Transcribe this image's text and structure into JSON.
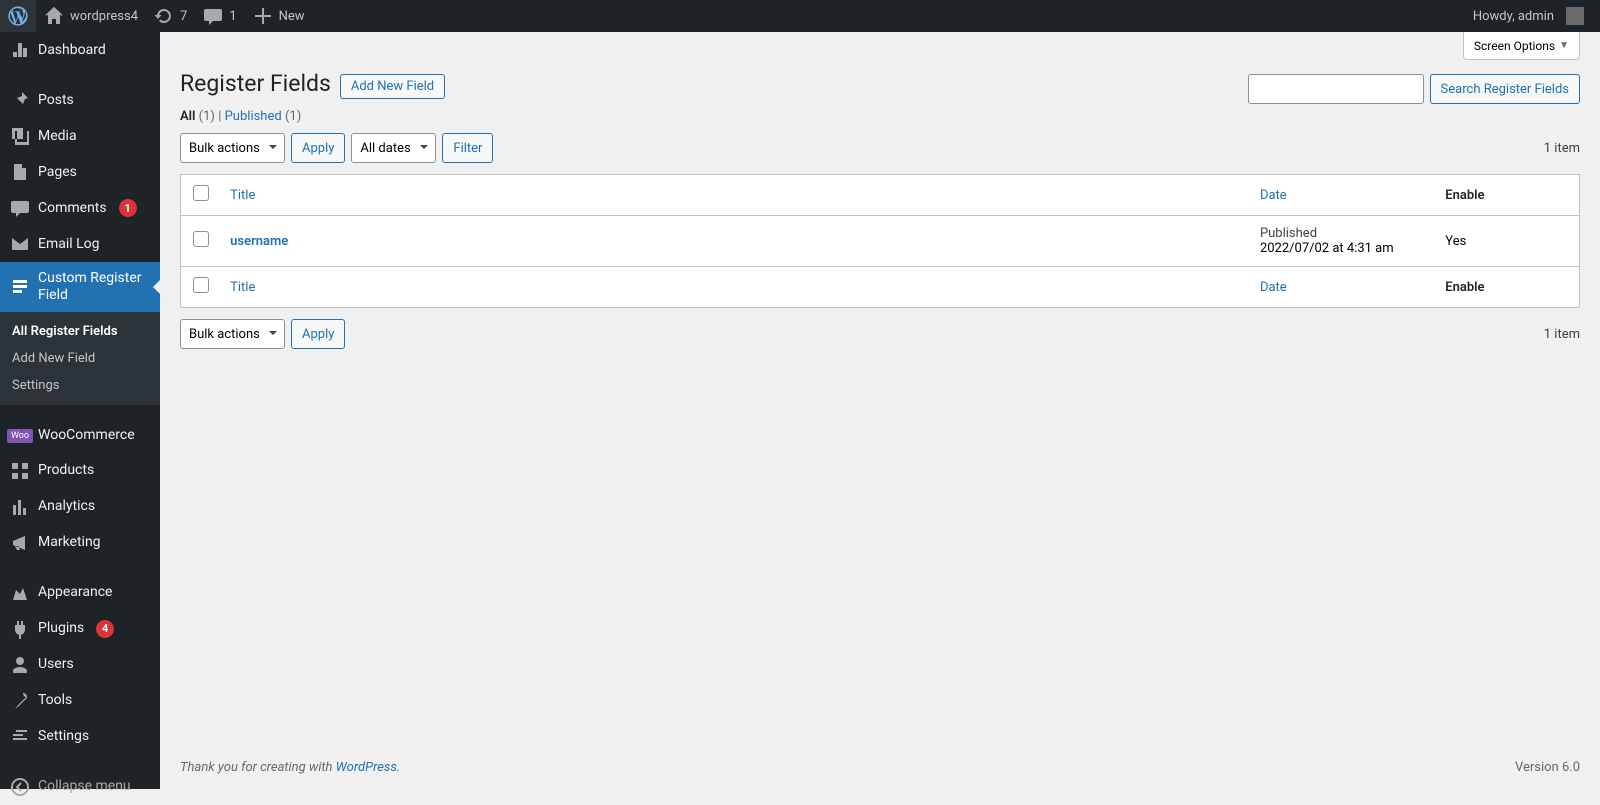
{
  "adminbar": {
    "site_name": "wordpress4",
    "updates": "7",
    "comments": "1",
    "new_label": "New",
    "howdy": "Howdy, admin"
  },
  "menu": {
    "dashboard": "Dashboard",
    "posts": "Posts",
    "media": "Media",
    "pages": "Pages",
    "comments": "Comments",
    "comments_badge": "1",
    "email_log": "Email Log",
    "custom_register_field": "Custom Register Field",
    "submenu": {
      "all": "All Register Fields",
      "add": "Add New Field",
      "settings": "Settings"
    },
    "woocommerce": "WooCommerce",
    "products": "Products",
    "analytics": "Analytics",
    "marketing": "Marketing",
    "appearance": "Appearance",
    "plugins": "Plugins",
    "plugins_badge": "4",
    "users": "Users",
    "tools": "Tools",
    "settings": "Settings",
    "collapse": "Collapse menu"
  },
  "screen": {
    "screen_options": "Screen Options",
    "page_title": "Register Fields",
    "add_new": "Add New Field",
    "filters": {
      "all_label": "All",
      "all_count": "(1)",
      "sep": " | ",
      "published_label": "Published",
      "published_count": "(1)"
    },
    "search_button": "Search Register Fields",
    "bulk_actions": "Bulk actions",
    "apply": "Apply",
    "all_dates": "All dates",
    "filter": "Filter",
    "item_count": "1 item",
    "columns": {
      "title": "Title",
      "date": "Date",
      "enable": "Enable"
    },
    "row": {
      "title": "username",
      "status": "Published",
      "date": "2022/07/02 at 4:31 am",
      "enable": "Yes"
    }
  },
  "footer": {
    "text_pre": "Thank you for creating with ",
    "link": "WordPress",
    "text_post": ".",
    "version": "Version 6.0"
  }
}
